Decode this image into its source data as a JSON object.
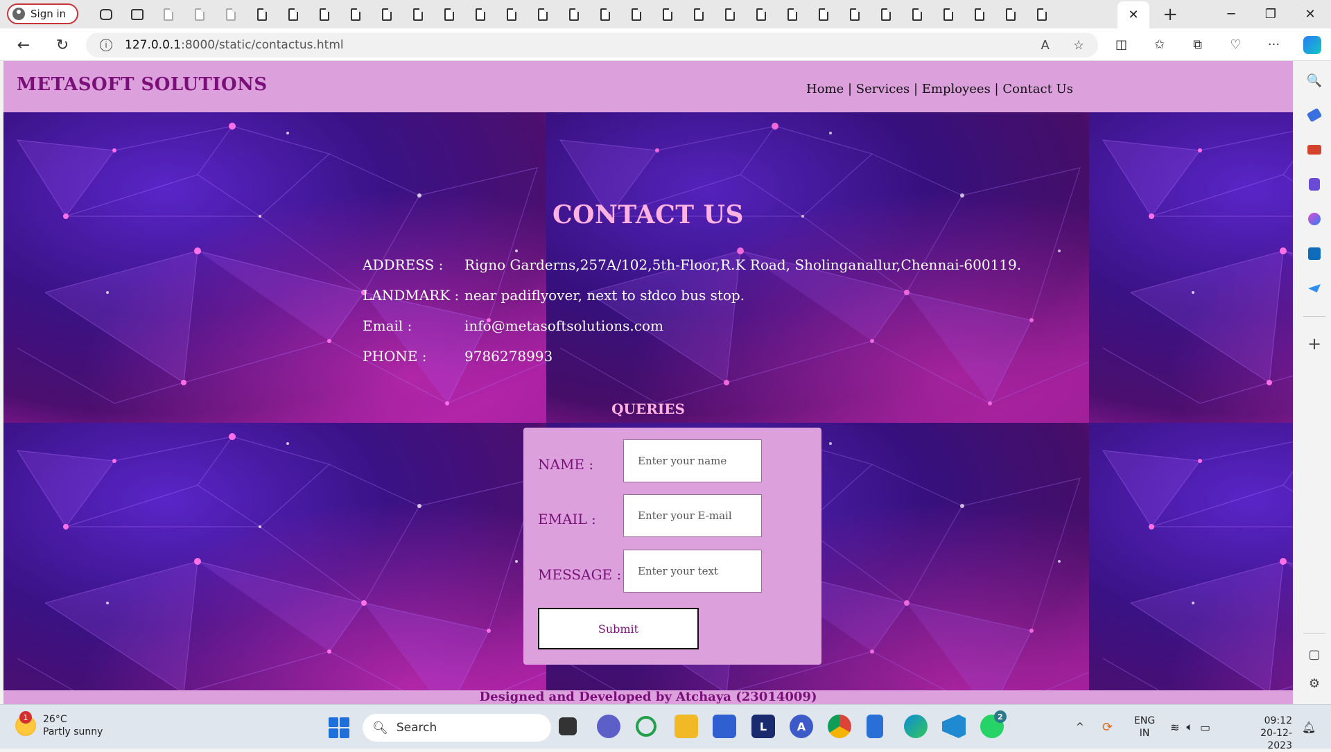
{
  "browser": {
    "signin_label": "Sign in",
    "url_host": "127.0.0.1",
    "url_rest": ":8000/static/contactus.html",
    "tab_close": "✕",
    "new_tab": "+"
  },
  "site": {
    "brand": "METASOFT SOLUTIONS",
    "nav": [
      "Home",
      "Services",
      "Employees",
      "Contact Us"
    ],
    "nav_sep": " | ",
    "title": "CONTACT US",
    "info": [
      {
        "label": "ADDRESS :",
        "value": "Rigno Garderns,257A/102,5th-Floor,R.K Road, Sholinganallur,Chennai-600119."
      },
      {
        "label": "LANDMARK :",
        "value": "near padiflyover, next to sidco bus stop."
      },
      {
        "label": "Email :",
        "value": "info@metasoftsolutions.com"
      },
      {
        "label": "PHONE :",
        "value": "9786278993"
      }
    ],
    "queries_heading": "QUERIES",
    "form": {
      "name_label": "NAME :",
      "name_placeholder": "Enter your name",
      "email_label": "EMAIL :",
      "email_placeholder": "Enter your E-mail",
      "message_label": "MESSAGE :",
      "message_placeholder": "Enter your text",
      "submit_label": "Submit"
    },
    "footer": "Designed and Developed by Atchaya (23014009)",
    "colors": {
      "header_bg": "#dca0dc",
      "brand": "#7a0f7a",
      "title": "#ffb2e0"
    }
  },
  "taskbar": {
    "weather_temp": "26°C",
    "weather_desc": "Partly sunny",
    "weather_badge": "1",
    "search_label": "Search",
    "whatsapp_badge": "2",
    "lang_top": "ENG",
    "lang_bottom": "IN",
    "time": "09:12",
    "date": "20-12-2023"
  }
}
